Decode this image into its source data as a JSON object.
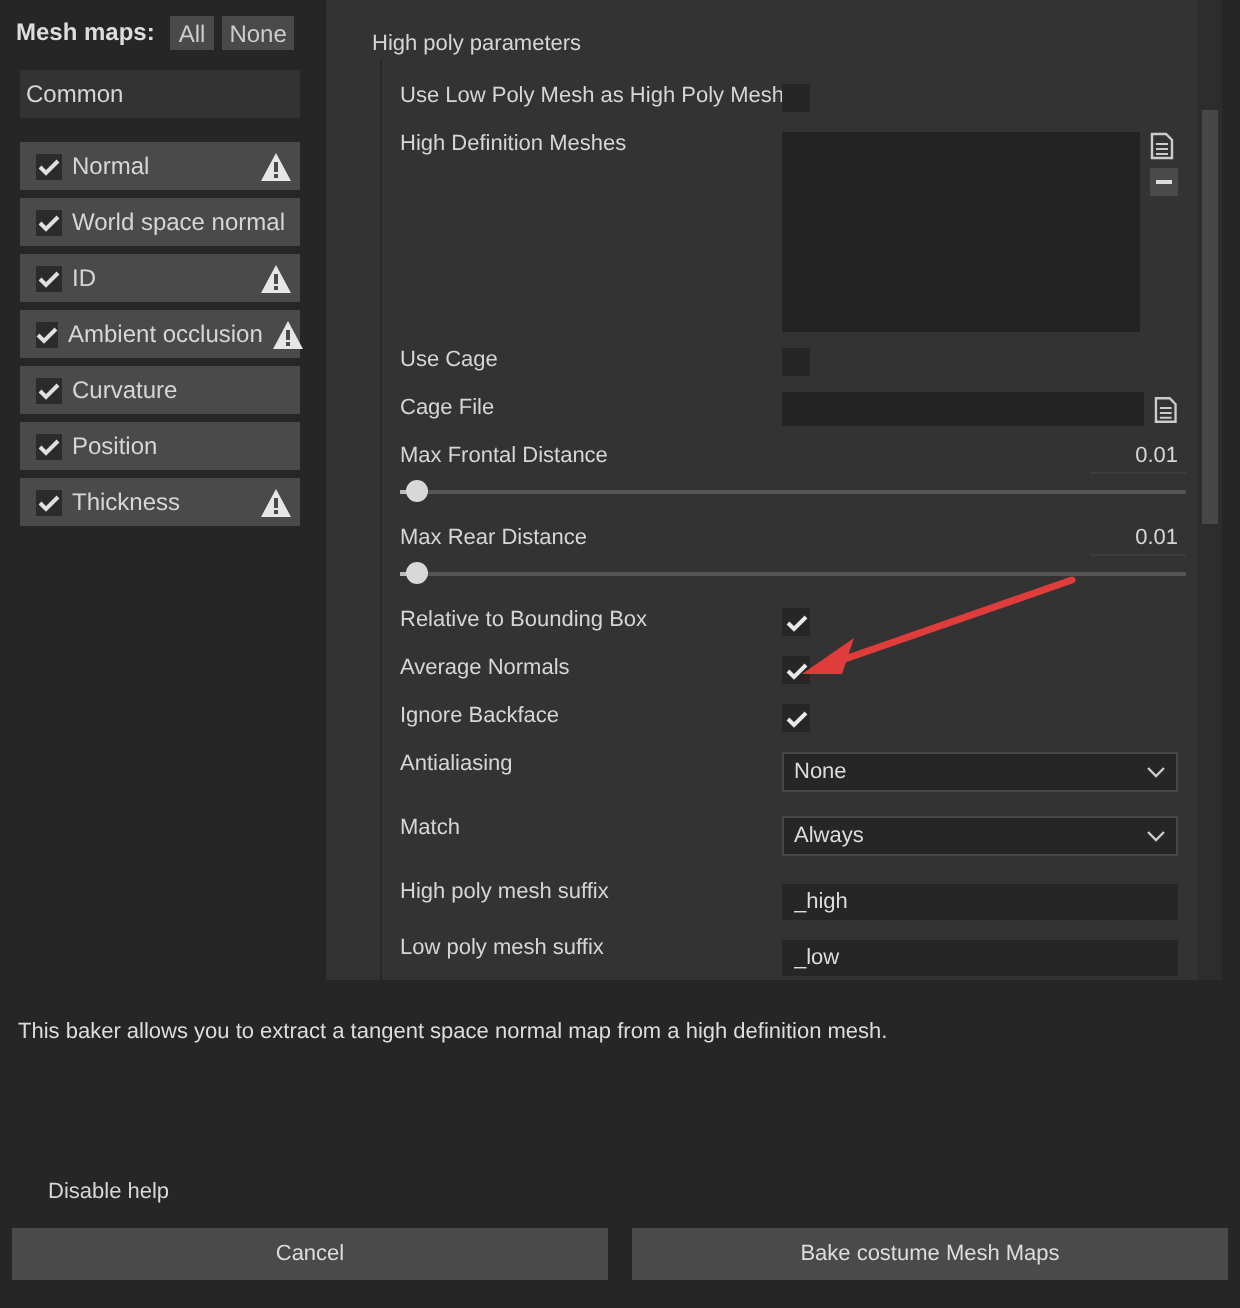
{
  "mesh_maps": {
    "title": "Mesh maps:",
    "buttons": [
      "All",
      "None"
    ],
    "group": "Common",
    "items": [
      {
        "label": "Normal",
        "checked": true,
        "warning": true
      },
      {
        "label": "World space normal",
        "checked": true,
        "warning": false
      },
      {
        "label": "ID",
        "checked": true,
        "warning": true
      },
      {
        "label": "Ambient occlusion",
        "checked": true,
        "warning": true
      },
      {
        "label": "Curvature",
        "checked": true,
        "warning": false
      },
      {
        "label": "Position",
        "checked": true,
        "warning": false
      },
      {
        "label": "Thickness",
        "checked": true,
        "warning": true
      }
    ]
  },
  "parameters": {
    "section": "High poly parameters",
    "rows": [
      {
        "kind": "checkbox",
        "label": "Use Low Poly Mesh as High Poly Mesh",
        "checked": false
      },
      {
        "kind": "list",
        "label": "High Definition Meshes"
      },
      {
        "kind": "checkbox",
        "label": "Use Cage",
        "checked": false
      },
      {
        "kind": "file",
        "label": "Cage File"
      },
      {
        "kind": "slider",
        "label": "Max Frontal Distance",
        "reading": "0.01",
        "level": 0.02
      },
      {
        "kind": "slider",
        "label": "Max Rear Distance",
        "reading": "0.01",
        "level": 0.02
      },
      {
        "kind": "checkbox",
        "label": "Relative to Bounding Box",
        "checked": true
      },
      {
        "kind": "checkbox",
        "label": "Average Normals",
        "checked": true
      },
      {
        "kind": "checkbox",
        "label": "Ignore Backface",
        "checked": true
      },
      {
        "kind": "select",
        "label": "Antialiasing",
        "value": "None"
      },
      {
        "kind": "select",
        "label": "Match",
        "value": "Always"
      },
      {
        "kind": "text",
        "label": "High poly mesh suffix",
        "value": "_high"
      },
      {
        "kind": "text",
        "label": "Low poly mesh suffix",
        "value": "_low"
      }
    ]
  },
  "help_text": "This baker allows you to extract a tangent space normal map from a high definition mesh.",
  "disable_help": "Disable help",
  "buttons": [
    "Cancel",
    "Bake costume Mesh Maps"
  ]
}
